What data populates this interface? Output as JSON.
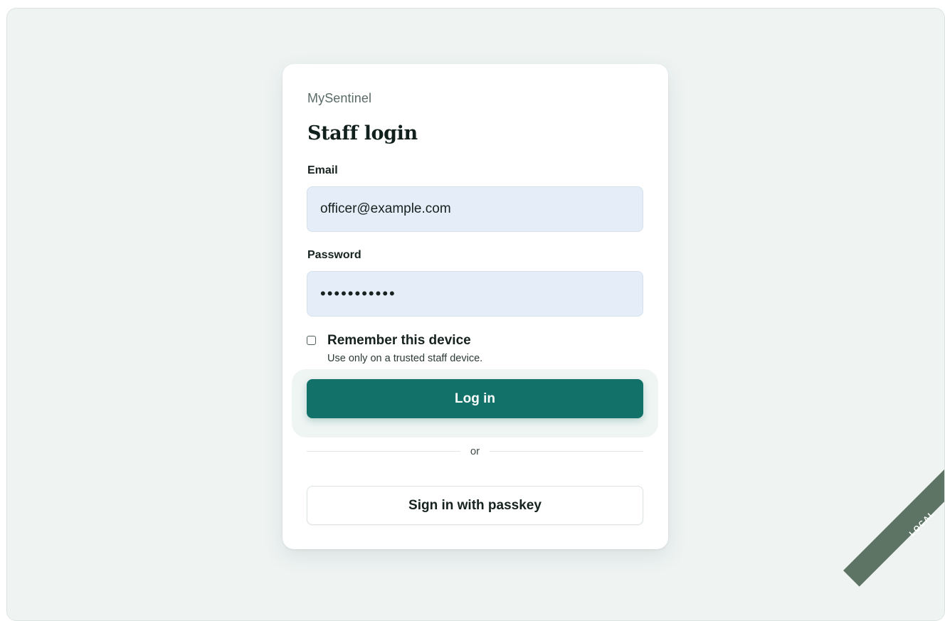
{
  "brand": "MySentinel",
  "title": "Staff login",
  "email": {
    "label": "Email",
    "value": "officer@example.com"
  },
  "password": {
    "label": "Password",
    "value": "•••••••••••"
  },
  "remember": {
    "label": "Remember this device",
    "hint": "Use only on a trusted staff device.",
    "checked": false
  },
  "actions": {
    "login_label": "Log in",
    "divider_text": "or",
    "passkey_label": "Sign in with passkey"
  },
  "environment_badge": "LOCAL",
  "colors": {
    "accent": "#127169",
    "background": "#eff4f3",
    "input_fill": "#e5eef8",
    "badge": "#5d7464"
  }
}
